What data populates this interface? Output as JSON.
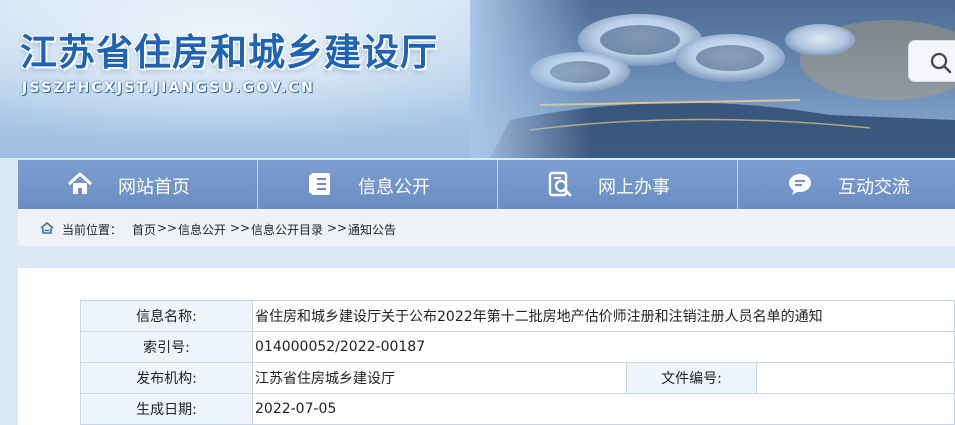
{
  "header": {
    "site_title": "江苏省住房和城乡建设厅",
    "site_domain": "JSSZFHCXJST.JIANGSU.GOV.CN",
    "search_icon": "search-icon"
  },
  "nav": {
    "items": [
      {
        "label": "网站首页",
        "icon": "home-icon"
      },
      {
        "label": "信息公开",
        "icon": "document-list-icon"
      },
      {
        "label": "网上办事",
        "icon": "document-search-icon"
      },
      {
        "label": "互动交流",
        "icon": "chat-bubble-icon"
      }
    ]
  },
  "breadcrumb": {
    "prefix": "当前位置：",
    "items": [
      "首页",
      ">>",
      "信息公开",
      ">>",
      "信息公开目录",
      ">>",
      "通知公告"
    ]
  },
  "info": {
    "rows": [
      {
        "label": "信息名称:",
        "value": "省住房和城乡建设厅关于公布2022年第十二批房地产估价师注册和注销注册人员名单的通知"
      },
      {
        "label": "索引号:",
        "value": "014000052/2022-00187"
      },
      {
        "label": "发布机构:",
        "value": "江苏省住房城乡建设厅",
        "label2": "文件编号:",
        "value2": ""
      },
      {
        "label": "生成日期:",
        "value": "2022-07-05"
      }
    ]
  },
  "colors": {
    "title_blue": "#1f63b3",
    "nav_bg": "#6a8dc3",
    "label_bg": "#eef4fb"
  }
}
